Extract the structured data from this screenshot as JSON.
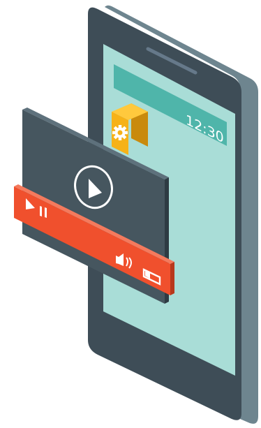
{
  "status_bar": {
    "time": "12:30"
  },
  "icons": {
    "settings_app": "gear-icon",
    "play": "play-icon",
    "pause": "pause-icon",
    "volume": "speaker-volume-icon",
    "battery": "battery-icon"
  },
  "colors": {
    "phone_body": "#3e4d57",
    "phone_side": "#6e858f",
    "screen": "#a9ddd7",
    "status_bar": "#4fb5aa",
    "settings_tile": "#f6b218",
    "video_panel": "#46565f",
    "player_bar": "#f0502d"
  }
}
